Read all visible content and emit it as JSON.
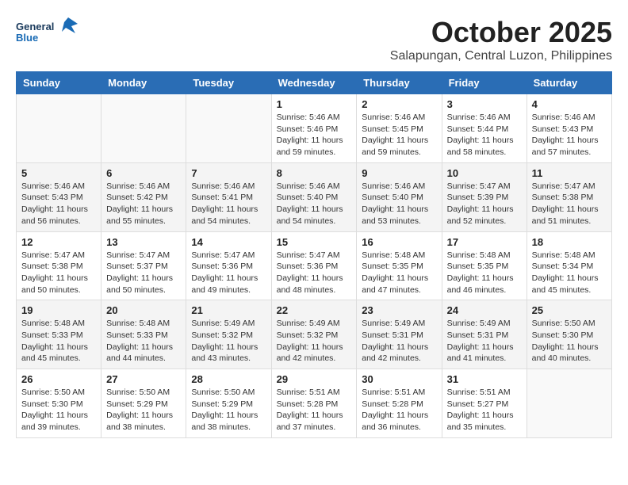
{
  "header": {
    "logo_line1": "General",
    "logo_line2": "Blue",
    "month_title": "October 2025",
    "subtitle": "Salapungan, Central Luzon, Philippines"
  },
  "weekdays": [
    "Sunday",
    "Monday",
    "Tuesday",
    "Wednesday",
    "Thursday",
    "Friday",
    "Saturday"
  ],
  "weeks": [
    [
      {
        "day": "",
        "sunrise": "",
        "sunset": "",
        "daylight": ""
      },
      {
        "day": "",
        "sunrise": "",
        "sunset": "",
        "daylight": ""
      },
      {
        "day": "",
        "sunrise": "",
        "sunset": "",
        "daylight": ""
      },
      {
        "day": "1",
        "sunrise": "Sunrise: 5:46 AM",
        "sunset": "Sunset: 5:46 PM",
        "daylight": "Daylight: 11 hours and 59 minutes."
      },
      {
        "day": "2",
        "sunrise": "Sunrise: 5:46 AM",
        "sunset": "Sunset: 5:45 PM",
        "daylight": "Daylight: 11 hours and 59 minutes."
      },
      {
        "day": "3",
        "sunrise": "Sunrise: 5:46 AM",
        "sunset": "Sunset: 5:44 PM",
        "daylight": "Daylight: 11 hours and 58 minutes."
      },
      {
        "day": "4",
        "sunrise": "Sunrise: 5:46 AM",
        "sunset": "Sunset: 5:43 PM",
        "daylight": "Daylight: 11 hours and 57 minutes."
      }
    ],
    [
      {
        "day": "5",
        "sunrise": "Sunrise: 5:46 AM",
        "sunset": "Sunset: 5:43 PM",
        "daylight": "Daylight: 11 hours and 56 minutes."
      },
      {
        "day": "6",
        "sunrise": "Sunrise: 5:46 AM",
        "sunset": "Sunset: 5:42 PM",
        "daylight": "Daylight: 11 hours and 55 minutes."
      },
      {
        "day": "7",
        "sunrise": "Sunrise: 5:46 AM",
        "sunset": "Sunset: 5:41 PM",
        "daylight": "Daylight: 11 hours and 54 minutes."
      },
      {
        "day": "8",
        "sunrise": "Sunrise: 5:46 AM",
        "sunset": "Sunset: 5:40 PM",
        "daylight": "Daylight: 11 hours and 54 minutes."
      },
      {
        "day": "9",
        "sunrise": "Sunrise: 5:46 AM",
        "sunset": "Sunset: 5:40 PM",
        "daylight": "Daylight: 11 hours and 53 minutes."
      },
      {
        "day": "10",
        "sunrise": "Sunrise: 5:47 AM",
        "sunset": "Sunset: 5:39 PM",
        "daylight": "Daylight: 11 hours and 52 minutes."
      },
      {
        "day": "11",
        "sunrise": "Sunrise: 5:47 AM",
        "sunset": "Sunset: 5:38 PM",
        "daylight": "Daylight: 11 hours and 51 minutes."
      }
    ],
    [
      {
        "day": "12",
        "sunrise": "Sunrise: 5:47 AM",
        "sunset": "Sunset: 5:38 PM",
        "daylight": "Daylight: 11 hours and 50 minutes."
      },
      {
        "day": "13",
        "sunrise": "Sunrise: 5:47 AM",
        "sunset": "Sunset: 5:37 PM",
        "daylight": "Daylight: 11 hours and 50 minutes."
      },
      {
        "day": "14",
        "sunrise": "Sunrise: 5:47 AM",
        "sunset": "Sunset: 5:36 PM",
        "daylight": "Daylight: 11 hours and 49 minutes."
      },
      {
        "day": "15",
        "sunrise": "Sunrise: 5:47 AM",
        "sunset": "Sunset: 5:36 PM",
        "daylight": "Daylight: 11 hours and 48 minutes."
      },
      {
        "day": "16",
        "sunrise": "Sunrise: 5:48 AM",
        "sunset": "Sunset: 5:35 PM",
        "daylight": "Daylight: 11 hours and 47 minutes."
      },
      {
        "day": "17",
        "sunrise": "Sunrise: 5:48 AM",
        "sunset": "Sunset: 5:35 PM",
        "daylight": "Daylight: 11 hours and 46 minutes."
      },
      {
        "day": "18",
        "sunrise": "Sunrise: 5:48 AM",
        "sunset": "Sunset: 5:34 PM",
        "daylight": "Daylight: 11 hours and 45 minutes."
      }
    ],
    [
      {
        "day": "19",
        "sunrise": "Sunrise: 5:48 AM",
        "sunset": "Sunset: 5:33 PM",
        "daylight": "Daylight: 11 hours and 45 minutes."
      },
      {
        "day": "20",
        "sunrise": "Sunrise: 5:48 AM",
        "sunset": "Sunset: 5:33 PM",
        "daylight": "Daylight: 11 hours and 44 minutes."
      },
      {
        "day": "21",
        "sunrise": "Sunrise: 5:49 AM",
        "sunset": "Sunset: 5:32 PM",
        "daylight": "Daylight: 11 hours and 43 minutes."
      },
      {
        "day": "22",
        "sunrise": "Sunrise: 5:49 AM",
        "sunset": "Sunset: 5:32 PM",
        "daylight": "Daylight: 11 hours and 42 minutes."
      },
      {
        "day": "23",
        "sunrise": "Sunrise: 5:49 AM",
        "sunset": "Sunset: 5:31 PM",
        "daylight": "Daylight: 11 hours and 42 minutes."
      },
      {
        "day": "24",
        "sunrise": "Sunrise: 5:49 AM",
        "sunset": "Sunset: 5:31 PM",
        "daylight": "Daylight: 11 hours and 41 minutes."
      },
      {
        "day": "25",
        "sunrise": "Sunrise: 5:50 AM",
        "sunset": "Sunset: 5:30 PM",
        "daylight": "Daylight: 11 hours and 40 minutes."
      }
    ],
    [
      {
        "day": "26",
        "sunrise": "Sunrise: 5:50 AM",
        "sunset": "Sunset: 5:30 PM",
        "daylight": "Daylight: 11 hours and 39 minutes."
      },
      {
        "day": "27",
        "sunrise": "Sunrise: 5:50 AM",
        "sunset": "Sunset: 5:29 PM",
        "daylight": "Daylight: 11 hours and 38 minutes."
      },
      {
        "day": "28",
        "sunrise": "Sunrise: 5:50 AM",
        "sunset": "Sunset: 5:29 PM",
        "daylight": "Daylight: 11 hours and 38 minutes."
      },
      {
        "day": "29",
        "sunrise": "Sunrise: 5:51 AM",
        "sunset": "Sunset: 5:28 PM",
        "daylight": "Daylight: 11 hours and 37 minutes."
      },
      {
        "day": "30",
        "sunrise": "Sunrise: 5:51 AM",
        "sunset": "Sunset: 5:28 PM",
        "daylight": "Daylight: 11 hours and 36 minutes."
      },
      {
        "day": "31",
        "sunrise": "Sunrise: 5:51 AM",
        "sunset": "Sunset: 5:27 PM",
        "daylight": "Daylight: 11 hours and 35 minutes."
      },
      {
        "day": "",
        "sunrise": "",
        "sunset": "",
        "daylight": ""
      }
    ]
  ]
}
